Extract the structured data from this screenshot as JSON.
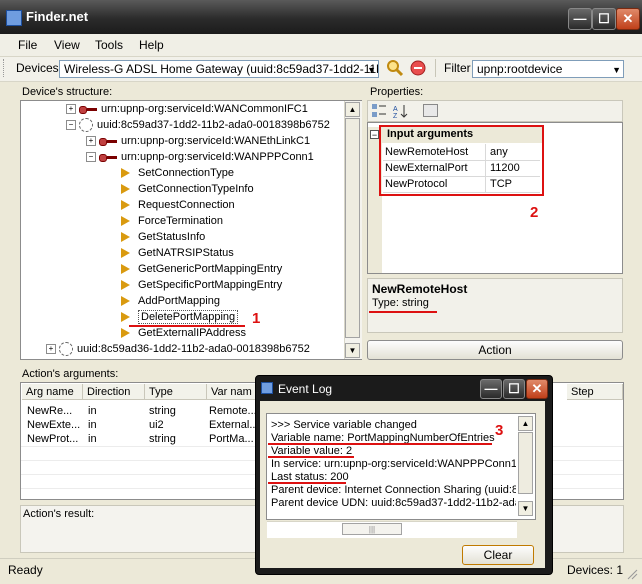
{
  "window": {
    "title": "Finder.net",
    "min": "—",
    "max": "☐",
    "close": "✕"
  },
  "menu": [
    "File",
    "View",
    "Tools",
    "Help"
  ],
  "toolbar": {
    "devices_label": "Devices",
    "devices_value": "Wireless-G ADSL Home Gateway (uuid:8c59ad37-1dd2-11b2-a",
    "filter_label": "Filter",
    "filter_value": "upnp:rootdevice"
  },
  "structure": {
    "heading": "Device's structure:",
    "rows": [
      "urn:upnp-org:serviceId:WANCommonIFC1",
      "uuid:8c59ad37-1dd2-11b2-ada0-0018398b6752",
      "urn:upnp-org:serviceId:WANEthLinkC1",
      "urn:upnp-org:serviceId:WANPPPConn1",
      "SetConnectionType",
      "GetConnectionTypeInfo",
      "RequestConnection",
      "ForceTermination",
      "GetStatusInfo",
      "GetNATRSIPStatus",
      "GetGenericPortMappingEntry",
      "GetSpecificPortMappingEntry",
      "AddPortMapping",
      "DeletePortMapping",
      "GetExternalIPAddress",
      "uuid:8c59ad36-1dd2-11b2-ada0-0018398b6752"
    ],
    "marker": "1"
  },
  "properties": {
    "heading": "Properties:",
    "category": "Input arguments",
    "items": [
      {
        "name": "NewRemoteHost",
        "value": "any"
      },
      {
        "name": "NewExternalPort",
        "value": "11200"
      },
      {
        "name": "NewProtocol",
        "value": "TCP"
      }
    ],
    "marker": "2",
    "selected_name": "NewRemoteHost",
    "selected_type": "Type: string",
    "action_button": "Action"
  },
  "arguments": {
    "heading": "Action's arguments:",
    "columns": [
      "Arg name",
      "Direction",
      "Type",
      "Var nam",
      "Step"
    ],
    "rows": [
      [
        "NewRe...",
        "in",
        "string",
        "Remote..."
      ],
      [
        "NewExte...",
        "in",
        "ui2",
        "External..."
      ],
      [
        "NewProt...",
        "in",
        "string",
        "PortMa..."
      ]
    ]
  },
  "result": {
    "heading": "Action's result:"
  },
  "event_log": {
    "title": "Event Log",
    "lines": [
      ">>> Service variable changed",
      "Variable name: PortMappingNumberOfEntries",
      "Variable value: 2",
      "In service: urn:upnp-org:serviceId:WANPPPConn1",
      "Last status: 200",
      "Parent device: Internet Connection Sharing (uuid:8c",
      "Parent device UDN: uuid:8c59ad37-1dd2-11b2-ada"
    ],
    "marker": "3",
    "clear_button": "Clear"
  },
  "status": {
    "left": "Ready",
    "right": "Devices: 1"
  }
}
